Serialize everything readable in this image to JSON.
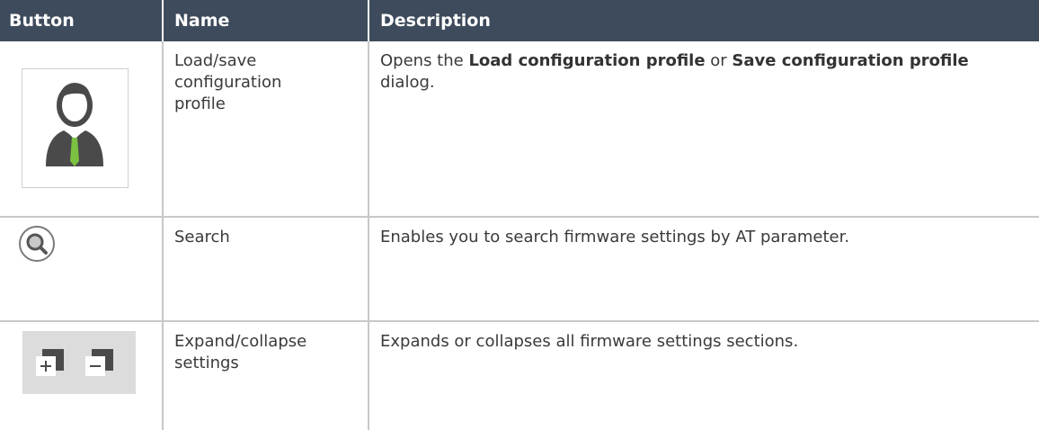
{
  "table": {
    "headers": {
      "button": "Button",
      "name": "Name",
      "description": "Description"
    },
    "rows": [
      {
        "icon": "profile-icon",
        "name": "Load/save configuration profile",
        "desc_before": "Opens the ",
        "desc_bold_1": "Load configuration profile",
        "desc_middle": " or ",
        "desc_bold_2": "Save configuration profile",
        "desc_after": " dialog."
      },
      {
        "icon": "search-icon",
        "name": "Search",
        "description": "Enables you to search firmware settings by AT parameter."
      },
      {
        "icon": "expand-collapse-icon",
        "name": "Expand/collapse settings",
        "description": "Expands or collapses all firmware settings sections."
      }
    ]
  },
  "colors": {
    "header_bg": "#3e4b5c",
    "header_text": "#ffffff",
    "grid_line": "#c8c8c8",
    "tie_green": "#7cc242"
  }
}
